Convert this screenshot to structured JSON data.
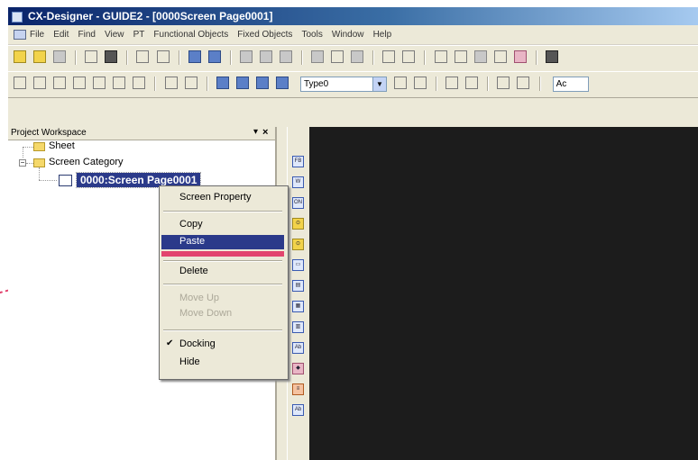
{
  "window": {
    "title": "CX-Designer - GUIDE2 - [0000Screen Page0001]"
  },
  "menu": {
    "items": [
      "File",
      "Edit",
      "Find",
      "View",
      "PT",
      "Functional Objects",
      "Fixed Objects",
      "Tools",
      "Window",
      "Help"
    ]
  },
  "toolbar2": {
    "type_value": "Type0",
    "act_value": "Ac"
  },
  "workspace": {
    "title": "Project Workspace",
    "pin_label": "▾",
    "close_label": "×",
    "tree": {
      "sheet_label": "Sheet",
      "category_label": "Screen Category",
      "expander": "−",
      "selected_label": "0000:Screen Page0001"
    }
  },
  "context_menu": {
    "items": [
      {
        "label": "Screen Property",
        "state": "normal"
      },
      {
        "label": "Copy",
        "state": "normal"
      },
      {
        "label": "Paste",
        "state": "highlighted"
      },
      {
        "label": "Delete",
        "state": "normal"
      },
      {
        "label": "Move Up",
        "state": "disabled"
      },
      {
        "label": "Move Down",
        "state": "disabled"
      },
      {
        "label": "Docking",
        "state": "checked"
      },
      {
        "label": "Hide",
        "state": "normal"
      }
    ],
    "check_glyph": "✔"
  },
  "object_strip": {
    "icons": [
      "FB",
      "W",
      "ON",
      "⊙",
      "⊙",
      "▭",
      "▤",
      "▦",
      "▥",
      "Ab",
      "◆",
      "≡",
      "Ab"
    ]
  },
  "colors": {
    "title_gradient_start": "#0a246a",
    "highlight": "#2b3a8a",
    "paste_bar": "#e2446e",
    "editor_bg": "#1c1c1c",
    "dotted_line": "#e2446e"
  },
  "icons": {
    "toolbar1": [
      "new-folder-icon",
      "open-icon",
      "save-all-icon",
      "new-file-icon",
      "save-icon",
      "copy-screen-icon",
      "paste-screen-icon",
      "grid-icon",
      "grid2-icon",
      "test-icon",
      "test2-icon",
      "transfer-icon",
      "print-preview-icon",
      "page-icon",
      "printer-icon",
      "undo-icon",
      "redo-icon",
      "cut-icon",
      "copy-icon",
      "paste-icon",
      "delete-icon",
      "bold-icon",
      "find-icon"
    ],
    "toolbar2": [
      "rectangle-icon",
      "circle-icon",
      "line-icon",
      "polyline-icon",
      "polygon-icon",
      "sector-icon",
      "arc-icon",
      "align-left-icon",
      "align-center-icon",
      "group-icon",
      "ungroup-icon",
      "front-icon",
      "back-icon"
    ]
  }
}
